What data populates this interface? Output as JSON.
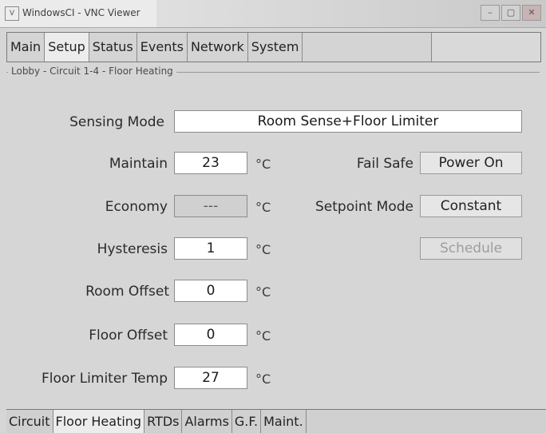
{
  "window": {
    "title": "WindowsCI - VNC Viewer",
    "icon": "app-icon",
    "controls": [
      "minimize-icon",
      "maximize-icon",
      "close-icon"
    ]
  },
  "top_tabs": [
    {
      "label": "Main",
      "active": false
    },
    {
      "label": "Setup",
      "active": true
    },
    {
      "label": "Status",
      "active": false
    },
    {
      "label": "Events",
      "active": false
    },
    {
      "label": "Network",
      "active": false
    },
    {
      "label": "System",
      "active": false
    }
  ],
  "group": {
    "label": "Lobby - Circuit 1-4 - Floor Heating"
  },
  "sensing_mode": {
    "label": "Sensing Mode",
    "value": "Room Sense+Floor Limiter"
  },
  "maintain": {
    "label": "Maintain",
    "value": "23",
    "unit": "°C"
  },
  "economy": {
    "label": "Economy",
    "value": "---",
    "unit": "°C"
  },
  "hysteresis": {
    "label": "Hysteresis",
    "value": "1",
    "unit": "°C"
  },
  "room_offset": {
    "label": "Room Offset",
    "value": "0",
    "unit": "°C"
  },
  "floor_offset": {
    "label": "Floor Offset",
    "value": "0",
    "unit": "°C"
  },
  "floor_limiter_temp": {
    "label": "Floor Limiter Temp",
    "value": "27",
    "unit": "°C"
  },
  "fail_safe": {
    "label": "Fail Safe",
    "value": "Power On"
  },
  "setpoint_mode": {
    "label": "Setpoint Mode",
    "value": "Constant"
  },
  "schedule": {
    "label": "Schedule",
    "enabled": false
  },
  "bottom_tabs": [
    {
      "label": "Circuit",
      "active": false
    },
    {
      "label": "Floor Heating",
      "active": true
    },
    {
      "label": "RTDs",
      "active": false
    },
    {
      "label": "Alarms",
      "active": false
    },
    {
      "label": "G.F.",
      "active": false
    },
    {
      "label": "Maint.",
      "active": false
    }
  ]
}
